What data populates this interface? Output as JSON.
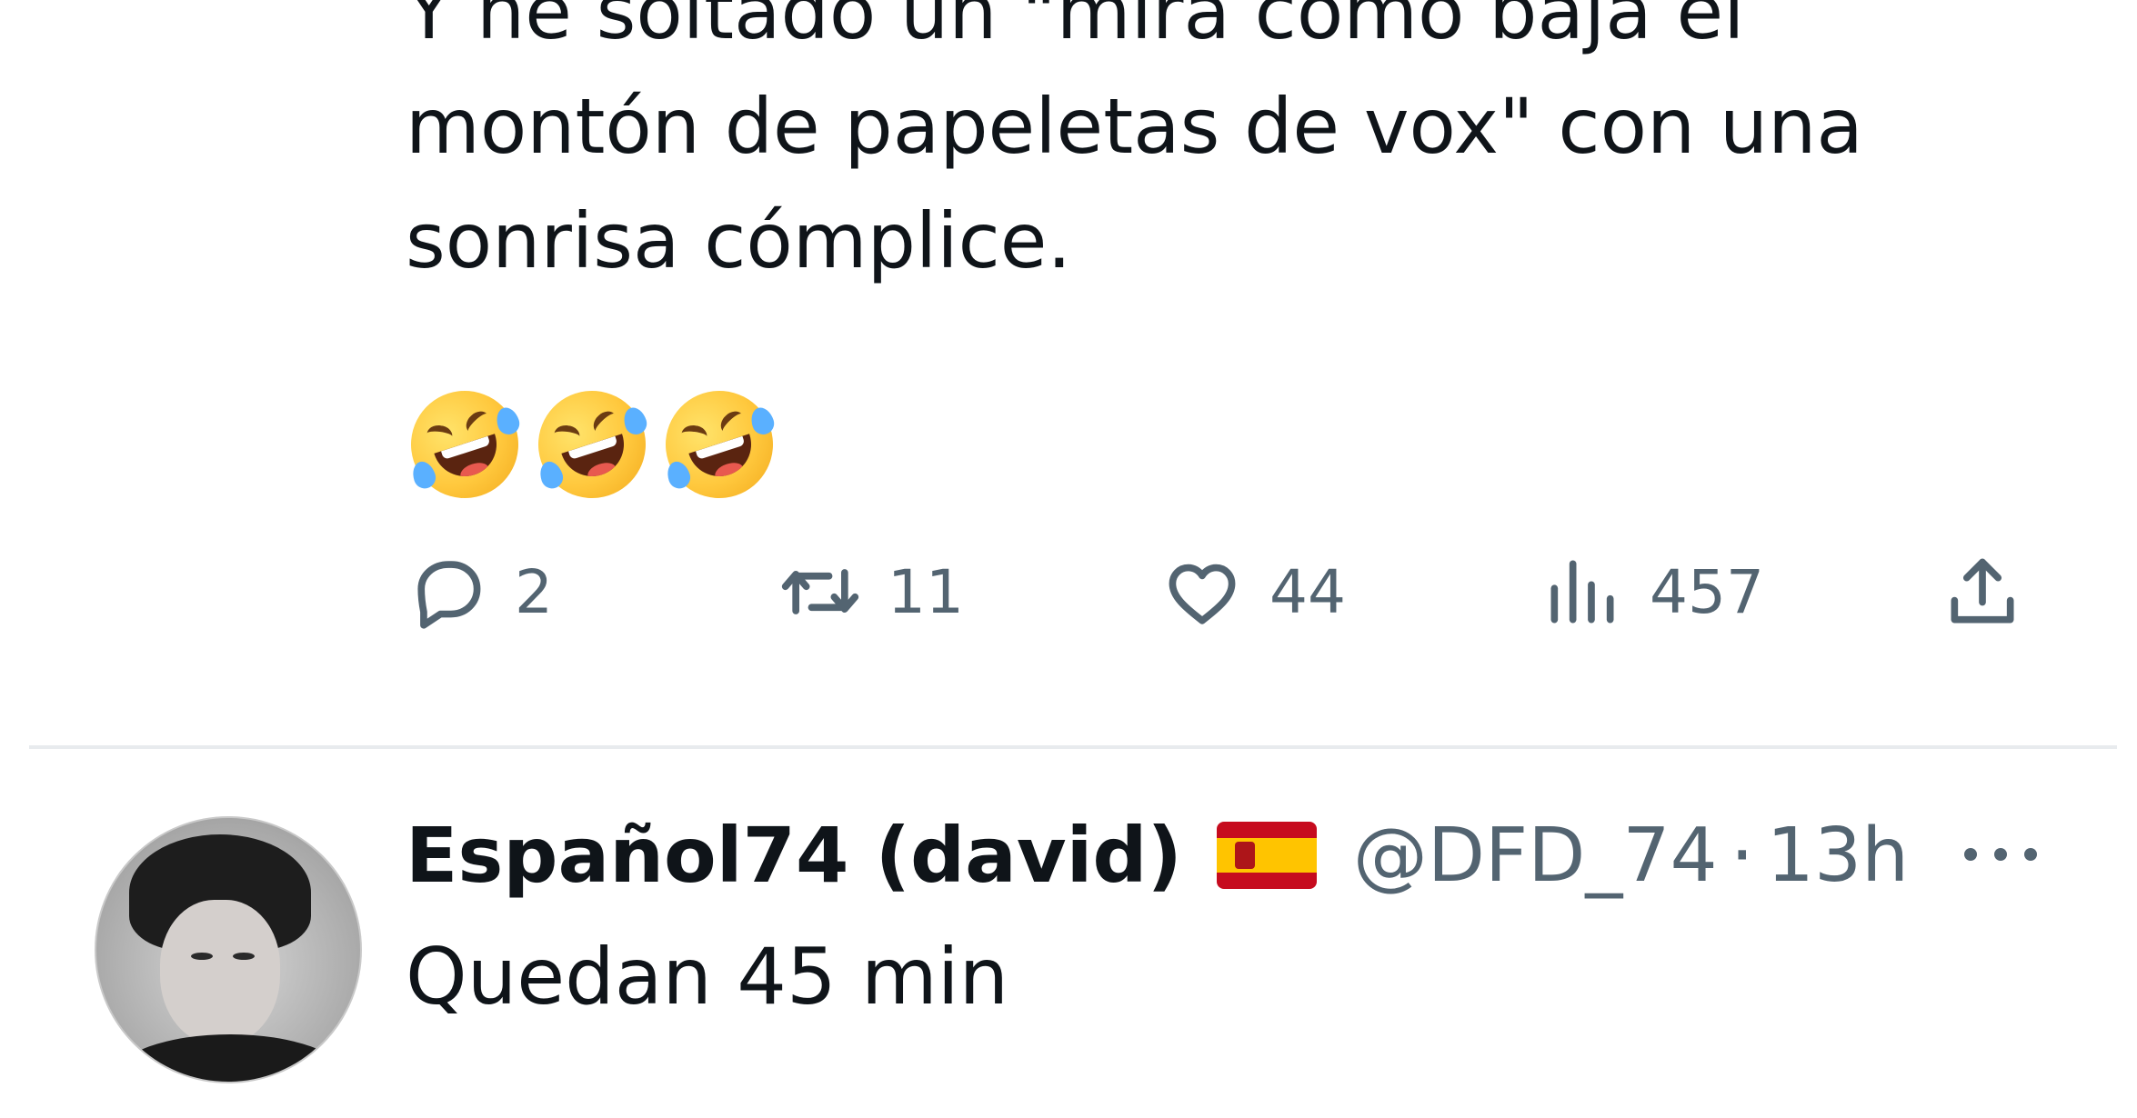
{
  "tweet": {
    "text_lines": [
      "Y he soltado un \"mira como baja el",
      "montón de papeletas de vox\" con una",
      "sonrisa cómplice."
    ],
    "emojis": [
      "rolling-on-floor-laughing",
      "rolling-on-floor-laughing",
      "rolling-on-floor-laughing"
    ],
    "actions": {
      "reply_count": "2",
      "retweet_count": "11",
      "like_count": "44",
      "views_count": "457"
    }
  },
  "reply": {
    "display_name": "Español74 (david)",
    "flag_icon": "spain-flag-icon",
    "handle": "@DFD_74",
    "separator": "·",
    "time": "13h",
    "text": "Quedan 45 min"
  },
  "colors": {
    "text_primary": "#0f1419",
    "text_secondary": "#536471",
    "divider": "#e8ebee"
  }
}
